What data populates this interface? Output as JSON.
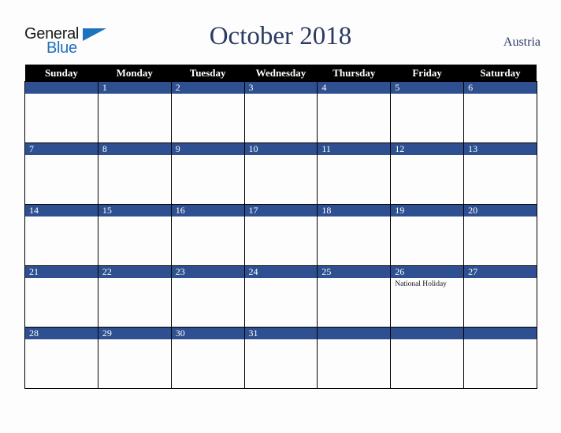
{
  "brand": {
    "name_part1": "General",
    "name_part2": "Blue",
    "triangle_icon": "triangle-icon",
    "accent_color": "#1f72bd"
  },
  "header": {
    "title": "October 2018",
    "country": "Austria",
    "title_color": "#2b3a63"
  },
  "calendar": {
    "month": "October",
    "year": "2018",
    "accent_color": "#2e5090",
    "header_bg": "#000000",
    "weekday_headers": [
      "Sunday",
      "Monday",
      "Tuesday",
      "Wednesday",
      "Thursday",
      "Friday",
      "Saturday"
    ],
    "weeks": [
      [
        {
          "day": "",
          "events": []
        },
        {
          "day": "1",
          "events": []
        },
        {
          "day": "2",
          "events": []
        },
        {
          "day": "3",
          "events": []
        },
        {
          "day": "4",
          "events": []
        },
        {
          "day": "5",
          "events": []
        },
        {
          "day": "6",
          "events": []
        }
      ],
      [
        {
          "day": "7",
          "events": []
        },
        {
          "day": "8",
          "events": []
        },
        {
          "day": "9",
          "events": []
        },
        {
          "day": "10",
          "events": []
        },
        {
          "day": "11",
          "events": []
        },
        {
          "day": "12",
          "events": []
        },
        {
          "day": "13",
          "events": []
        }
      ],
      [
        {
          "day": "14",
          "events": []
        },
        {
          "day": "15",
          "events": []
        },
        {
          "day": "16",
          "events": []
        },
        {
          "day": "17",
          "events": []
        },
        {
          "day": "18",
          "events": []
        },
        {
          "day": "19",
          "events": []
        },
        {
          "day": "20",
          "events": []
        }
      ],
      [
        {
          "day": "21",
          "events": []
        },
        {
          "day": "22",
          "events": []
        },
        {
          "day": "23",
          "events": []
        },
        {
          "day": "24",
          "events": []
        },
        {
          "day": "25",
          "events": []
        },
        {
          "day": "26",
          "events": [
            "National Holiday"
          ]
        },
        {
          "day": "27",
          "events": []
        }
      ],
      [
        {
          "day": "28",
          "events": []
        },
        {
          "day": "29",
          "events": []
        },
        {
          "day": "30",
          "events": []
        },
        {
          "day": "31",
          "events": []
        },
        {
          "day": "",
          "events": []
        },
        {
          "day": "",
          "events": []
        },
        {
          "day": "",
          "events": []
        }
      ]
    ]
  }
}
